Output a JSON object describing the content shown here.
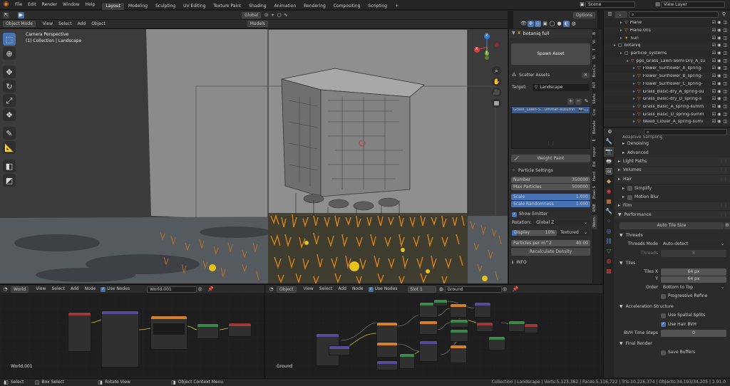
{
  "topbar": {
    "menus": [
      "File",
      "Edit",
      "Render",
      "Window",
      "Help"
    ],
    "workspaces": [
      "Layout",
      "Modeling",
      "Sculpting",
      "UV Editing",
      "Texture Paint",
      "Shading",
      "Animation",
      "Rendering",
      "Compositing",
      "Scripting"
    ],
    "active_workspace": "Layout",
    "scene": "Scene",
    "view_layer": "View Layer"
  },
  "viewport": {
    "mode": "Object Mode",
    "menus": [
      "View",
      "Select",
      "Add",
      "Object"
    ],
    "orientation": "Global",
    "models": "Models",
    "options": "Options",
    "camera_label": "Camera Perspective",
    "collection_label": "(1) Collection | Landscape",
    "gizmo_axes": {
      "x": "X",
      "y": "Y",
      "z": "Z"
    }
  },
  "botaniq": {
    "title": "botaniq full",
    "spawn": "Spawn Asset",
    "scatter": "Scatter Assets",
    "target_label": "Target:",
    "target_value": "Landscape",
    "list_item": "Grass_Lawn-S...ummer-autumn",
    "weight_paint": "Weight Paint",
    "particle_settings": "Particle Settings",
    "number_label": "Number",
    "number_value": "350000",
    "max_label": "Max Particles",
    "max_value": "500000",
    "scale_label": "Scale",
    "scale_value": "1.000",
    "scale_rand_label": "Scale Randomness",
    "scale_rand_value": "1.000",
    "show_emitter": "Show Emitter",
    "rotation_label": "Rotation:",
    "rotation_value": "Global Z",
    "display_label": "Display",
    "display_pct": "10%",
    "display_mode": "Textured",
    "ppm_label": "Particles per m^2",
    "ppm_value": "40.00",
    "recalc": "Recalculate Density",
    "info": "INFO"
  },
  "sidetabs": [
    "B",
    "Vi",
    "T",
    "Vi",
    "BoxCu",
    "KIT",
    "Sketc",
    "Cre",
    "Blende",
    "E",
    "mpor",
    "Ed",
    "Hard",
    "Pixel S",
    "RNE",
    "Wom"
  ],
  "outliner": [
    {
      "name": "Plane",
      "indent": 1
    },
    {
      "name": "Plane.001",
      "indent": 1
    },
    {
      "name": "Sun",
      "indent": 1
    },
    {
      "name": "botaniq",
      "indent": 0
    },
    {
      "name": "particle_systems",
      "indent": 1
    },
    {
      "name": "pps_Grass_Lawn-Semi-Dry_A_su",
      "indent": 2
    },
    {
      "name": "Flower_Sunflower_A_spring-",
      "indent": 3
    },
    {
      "name": "Flower_Sunflower_B_spring-",
      "indent": 3
    },
    {
      "name": "Flower_Sunflower_C_spring-",
      "indent": 3
    },
    {
      "name": "Grass_Basic-dry_A_spring-su",
      "indent": 3
    },
    {
      "name": "Grass_Basic-dry_D_spring-s",
      "indent": 3
    },
    {
      "name": "Grass_Basic_A_spring-summ",
      "indent": 3
    },
    {
      "name": "Grass_Basic_D_spring-summ",
      "indent": 3
    },
    {
      "name": "Weed_Clover_A_spring-sumi",
      "indent": 3
    }
  ],
  "properties": {
    "partial_top": "Adaptive Sampling",
    "rows": [
      {
        "type": "sub",
        "label": "Denoising"
      },
      {
        "type": "sub",
        "label": "Advanced"
      },
      {
        "type": "sec",
        "label": "Light Paths"
      },
      {
        "type": "sec",
        "label": "Volumes"
      },
      {
        "type": "sec",
        "label": "Hair"
      },
      {
        "type": "subcheck",
        "label": "Simplify"
      },
      {
        "type": "subcheck",
        "label": "Motion Blur"
      },
      {
        "type": "sec",
        "label": "Film"
      },
      {
        "type": "sec",
        "label": "Performance"
      }
    ],
    "auto_tile": "Auto Tile Size",
    "threads": "Threads",
    "threads_mode_label": "Threads Mode",
    "threads_mode_value": "Auto-detect",
    "threads_label": "Threads",
    "threads_value": "8",
    "tiles": "Tiles",
    "tiles_x_label": "Tiles X",
    "tiles_x_value": "64 px",
    "tiles_y_label": "Y",
    "tiles_y_value": "64 px",
    "order_label": "Order",
    "order_value": "Bottom to Top",
    "progressive": "Progressive Refine",
    "accel": "Acceleration Structure",
    "spatial": "Use Spatial Splits",
    "hair_bvh": "Use Hair BVH",
    "bvh_label": "BVH Time Steps",
    "bvh_value": "0",
    "final_render": "Final Render",
    "save_buffers": "Save Buffers"
  },
  "node_left": {
    "type": "World",
    "menus": [
      "View",
      "Select",
      "Add",
      "Node"
    ],
    "use_nodes": "Use Nodes",
    "datablock": "World.001",
    "footer": "World.001"
  },
  "node_right": {
    "type": "Object",
    "menus": [
      "View",
      "Select",
      "Add",
      "Node"
    ],
    "use_nodes": "Use Nodes",
    "slot": "Slot 1",
    "material": "Ground",
    "footer": "Ground"
  },
  "statusbar": {
    "left": [
      "Select",
      "Box Select",
      "Rotate View",
      "Object Context Menu"
    ],
    "right": "Collection | Landscape | Verts:5,123,362 | Faces:5,116,722 | Tris:10,226,374 | Objects:34,193/34,205 | 2.91.0"
  }
}
